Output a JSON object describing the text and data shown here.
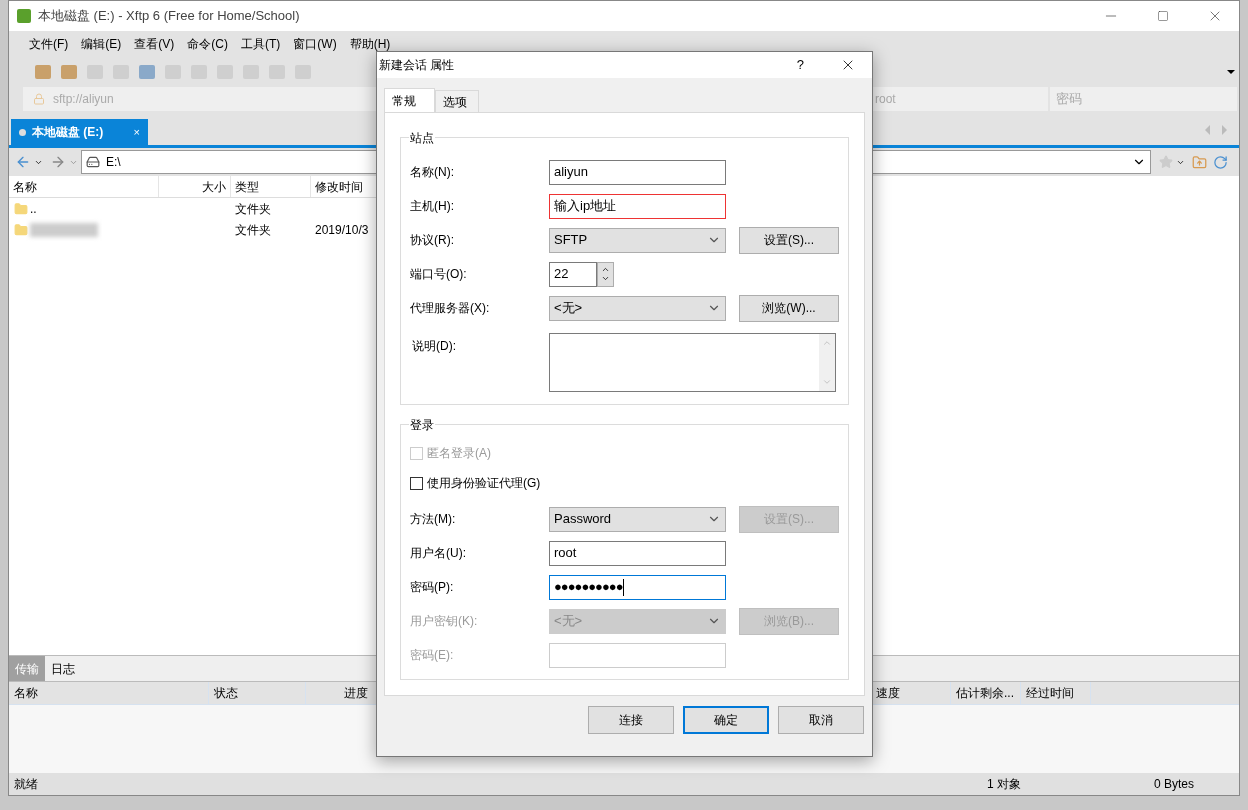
{
  "window": {
    "title": "本地磁盘 (E:) - Xftp 6 (Free for Home/School)"
  },
  "menu": [
    "文件(F)",
    "编辑(E)",
    "查看(V)",
    "命令(C)",
    "工具(T)",
    "窗口(W)",
    "帮助(H)"
  ],
  "session_bar": {
    "address": "sftp://aliyun",
    "user": "root",
    "password_placeholder": "密码"
  },
  "tabs": [
    {
      "label": "本地磁盘 (E:)",
      "selected": true,
      "close": "×"
    }
  ],
  "path": "E:\\",
  "file_columns": [
    "名称",
    "大小",
    "类型",
    "修改时间"
  ],
  "files": [
    {
      "name": "..",
      "type": "文件夹",
      "blurred": false
    },
    {
      "type": "文件夹",
      "modified": "2019/10/3",
      "blurred": true
    }
  ],
  "bottom_tabs": [
    {
      "label": "传输",
      "selected": true
    },
    {
      "label": "日志",
      "selected": false
    }
  ],
  "transfer_columns": [
    "名称",
    "状态",
    "进度",
    "速度",
    "估计剩余...",
    "经过时间"
  ],
  "status_bar": [
    "就绪",
    "1 对象",
    "0 Bytes"
  ],
  "dialog": {
    "title": "新建会话 属性",
    "help": "?",
    "tabs": [
      {
        "label": "常规",
        "selected": true
      },
      {
        "label": "选项",
        "selected": false
      }
    ],
    "site": {
      "title": "站点",
      "fields": [
        {
          "kind": "text",
          "label": "名称(N):",
          "value": "aliyun",
          "disabled": false,
          "highlighted": false,
          "focused": false
        },
        {
          "kind": "text",
          "label": "主机(H):",
          "value": "输入ip地址",
          "disabled": false,
          "highlighted": true,
          "focused": false
        },
        {
          "kind": "combo",
          "label": "协议(R):",
          "value": "SFTP",
          "disabled": false,
          "button": "设置(S)...",
          "button_disabled": false
        },
        {
          "kind": "spin",
          "label": "端口号(O):",
          "value": "22",
          "disabled": false
        },
        {
          "kind": "combo",
          "label": "代理服务器(X):",
          "value": "<无>",
          "disabled": false,
          "button": "浏览(W)...",
          "button_disabled": false
        },
        {
          "kind": "textarea",
          "label": "说明(D):",
          "disabled": false
        }
      ]
    },
    "login": {
      "title": "登录",
      "checkboxes": [
        {
          "label": "匿名登录(A)",
          "checked": false,
          "disabled": true
        },
        {
          "label": "使用身份验证代理(G)",
          "checked": false,
          "disabled": false
        }
      ],
      "fields": [
        {
          "kind": "combo",
          "label": "方法(M):",
          "value": "Password",
          "disabled": false,
          "button": "设置(S)...",
          "button_disabled": true
        },
        {
          "kind": "text",
          "label": "用户名(U):",
          "value": "root",
          "disabled": false,
          "highlighted": false,
          "focused": false
        },
        {
          "kind": "text",
          "label": "密码(P):",
          "value": "●●●●●●●●●●",
          "disabled": false,
          "highlighted": false,
          "focused": true
        },
        {
          "kind": "combo",
          "label": "用户密钥(K):",
          "value": "<无>",
          "disabled": true,
          "button": "浏览(B)...",
          "button_disabled": true
        },
        {
          "kind": "text",
          "label": "密码(E):",
          "disabled": true,
          "highlighted": false,
          "focused": false
        }
      ]
    },
    "buttons": [
      {
        "label": "连接",
        "default": false
      },
      {
        "label": "确定",
        "default": true
      },
      {
        "label": "取消",
        "default": false
      }
    ]
  }
}
